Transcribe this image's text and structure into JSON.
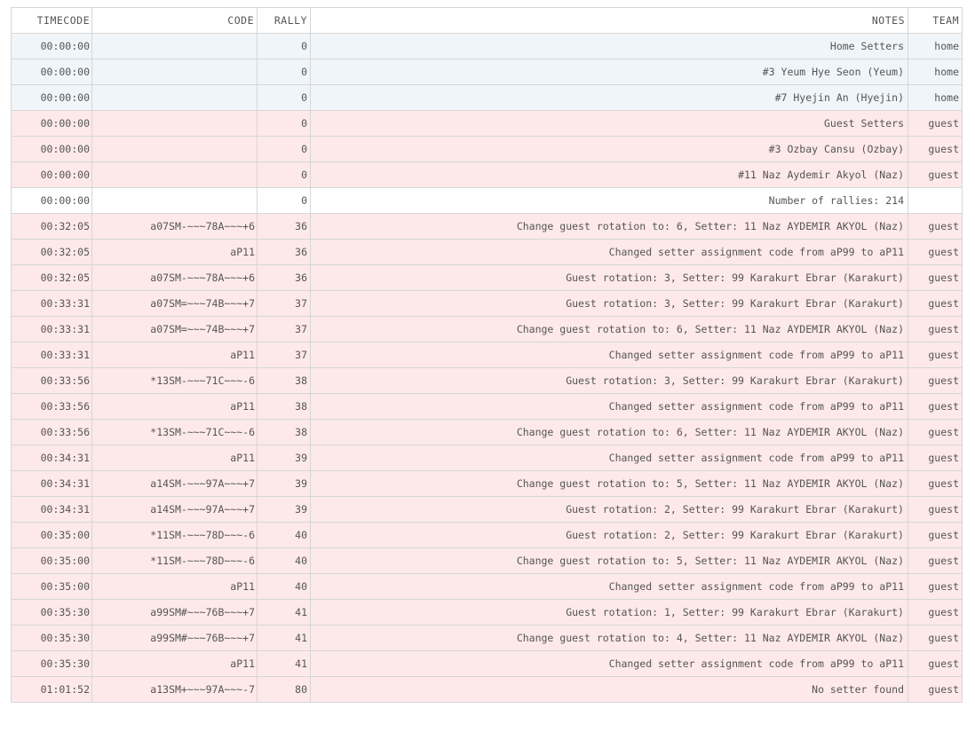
{
  "table": {
    "headers": {
      "timecode": "TIMECODE",
      "code": "CODE",
      "rally": "RALLY",
      "notes": "NOTES",
      "team": "TEAM"
    },
    "rows": [
      {
        "timecode": "00:00:00",
        "code": "",
        "rally": "0",
        "notes": "Home Setters",
        "team": "home",
        "kind": "home"
      },
      {
        "timecode": "00:00:00",
        "code": "",
        "rally": "0",
        "notes": "#3 Yeum Hye Seon (Yeum)",
        "team": "home",
        "kind": "home"
      },
      {
        "timecode": "00:00:00",
        "code": "",
        "rally": "0",
        "notes": "#7 Hyejin An (Hyejin)",
        "team": "home",
        "kind": "home"
      },
      {
        "timecode": "00:00:00",
        "code": "",
        "rally": "0",
        "notes": "Guest Setters",
        "team": "guest",
        "kind": "guest"
      },
      {
        "timecode": "00:00:00",
        "code": "",
        "rally": "0",
        "notes": "#3 Ozbay Cansu (Ozbay)",
        "team": "guest",
        "kind": "guest"
      },
      {
        "timecode": "00:00:00",
        "code": "",
        "rally": "0",
        "notes": "#11 Naz Aydemir Akyol (Naz)",
        "team": "guest",
        "kind": "guest"
      },
      {
        "timecode": "00:00:00",
        "code": "",
        "rally": "0",
        "notes": "Number of rallies: 214",
        "team": "",
        "kind": "neutral"
      },
      {
        "timecode": "00:32:05",
        "code": "a07SM-~~~78A~~~+6",
        "rally": "36",
        "notes": "Change guest rotation to: 6, Setter: 11 Naz AYDEMIR AKYOL (Naz)",
        "team": "guest",
        "kind": "guest"
      },
      {
        "timecode": "00:32:05",
        "code": "aP11",
        "rally": "36",
        "notes": "Changed setter assignment code from aP99 to aP11",
        "team": "guest",
        "kind": "guest"
      },
      {
        "timecode": "00:32:05",
        "code": "a07SM-~~~78A~~~+6",
        "rally": "36",
        "notes": "Guest rotation: 3, Setter: 99 Karakurt Ebrar (Karakurt)",
        "team": "guest",
        "kind": "guest"
      },
      {
        "timecode": "00:33:31",
        "code": "a07SM=~~~74B~~~+7",
        "rally": "37",
        "notes": "Guest rotation: 3, Setter: 99 Karakurt Ebrar (Karakurt)",
        "team": "guest",
        "kind": "guest"
      },
      {
        "timecode": "00:33:31",
        "code": "a07SM=~~~74B~~~+7",
        "rally": "37",
        "notes": "Change guest rotation to: 6, Setter: 11 Naz AYDEMIR AKYOL (Naz)",
        "team": "guest",
        "kind": "guest"
      },
      {
        "timecode": "00:33:31",
        "code": "aP11",
        "rally": "37",
        "notes": "Changed setter assignment code from aP99 to aP11",
        "team": "guest",
        "kind": "guest"
      },
      {
        "timecode": "00:33:56",
        "code": "*13SM-~~~71C~~~-6",
        "rally": "38",
        "notes": "Guest rotation: 3, Setter: 99 Karakurt Ebrar (Karakurt)",
        "team": "guest",
        "kind": "guest"
      },
      {
        "timecode": "00:33:56",
        "code": "aP11",
        "rally": "38",
        "notes": "Changed setter assignment code from aP99 to aP11",
        "team": "guest",
        "kind": "guest"
      },
      {
        "timecode": "00:33:56",
        "code": "*13SM-~~~71C~~~-6",
        "rally": "38",
        "notes": "Change guest rotation to: 6, Setter: 11 Naz AYDEMIR AKYOL (Naz)",
        "team": "guest",
        "kind": "guest"
      },
      {
        "timecode": "00:34:31",
        "code": "aP11",
        "rally": "39",
        "notes": "Changed setter assignment code from aP99 to aP11",
        "team": "guest",
        "kind": "guest"
      },
      {
        "timecode": "00:34:31",
        "code": "a14SM-~~~97A~~~+7",
        "rally": "39",
        "notes": "Change guest rotation to: 5, Setter: 11 Naz AYDEMIR AKYOL (Naz)",
        "team": "guest",
        "kind": "guest"
      },
      {
        "timecode": "00:34:31",
        "code": "a14SM-~~~97A~~~+7",
        "rally": "39",
        "notes": "Guest rotation: 2, Setter: 99 Karakurt Ebrar (Karakurt)",
        "team": "guest",
        "kind": "guest"
      },
      {
        "timecode": "00:35:00",
        "code": "*11SM-~~~78D~~~-6",
        "rally": "40",
        "notes": "Guest rotation: 2, Setter: 99 Karakurt Ebrar (Karakurt)",
        "team": "guest",
        "kind": "guest"
      },
      {
        "timecode": "00:35:00",
        "code": "*11SM-~~~78D~~~-6",
        "rally": "40",
        "notes": "Change guest rotation to: 5, Setter: 11 Naz AYDEMIR AKYOL (Naz)",
        "team": "guest",
        "kind": "guest"
      },
      {
        "timecode": "00:35:00",
        "code": "aP11",
        "rally": "40",
        "notes": "Changed setter assignment code from aP99 to aP11",
        "team": "guest",
        "kind": "guest"
      },
      {
        "timecode": "00:35:30",
        "code": "a99SM#~~~76B~~~+7",
        "rally": "41",
        "notes": "Guest rotation: 1, Setter: 99 Karakurt Ebrar (Karakurt)",
        "team": "guest",
        "kind": "guest"
      },
      {
        "timecode": "00:35:30",
        "code": "a99SM#~~~76B~~~+7",
        "rally": "41",
        "notes": "Change guest rotation to: 4, Setter: 11 Naz AYDEMIR AKYOL (Naz)",
        "team": "guest",
        "kind": "guest"
      },
      {
        "timecode": "00:35:30",
        "code": "aP11",
        "rally": "41",
        "notes": "Changed setter assignment code from aP99 to aP11",
        "team": "guest",
        "kind": "guest"
      },
      {
        "timecode": "01:01:52",
        "code": "a13SM+~~~97A~~~-7",
        "rally": "80",
        "notes": "No setter found",
        "team": "guest",
        "kind": "guest"
      }
    ]
  },
  "colors": {
    "home_row": "#f0f5f9",
    "guest_row": "#fee9ea",
    "neutral_row": "#ffffff",
    "grid_line": "#d6d6d6",
    "text": "#555555"
  }
}
